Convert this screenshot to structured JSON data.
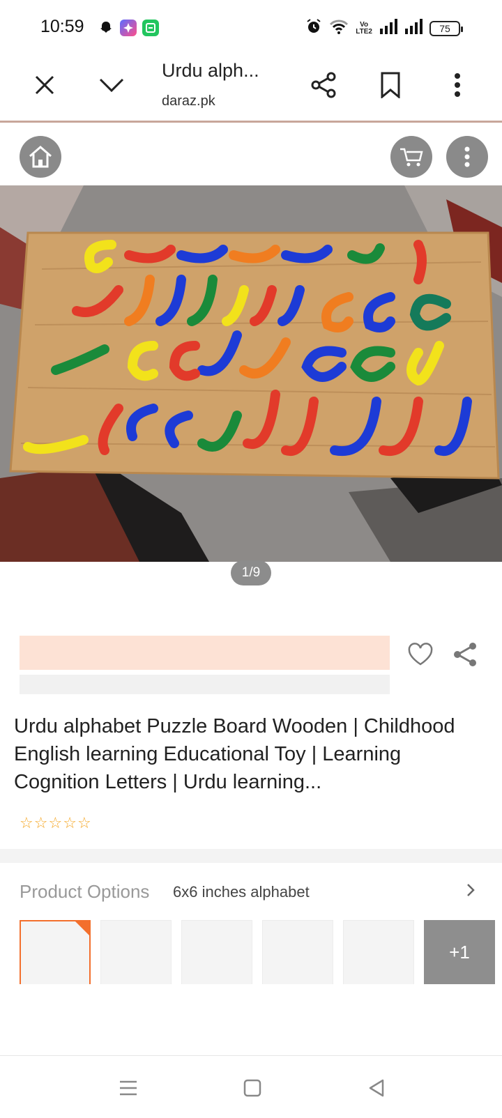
{
  "status_bar": {
    "time": "10:59",
    "battery": "75",
    "volte": "VoLTE2"
  },
  "tab_bar": {
    "title": "Urdu alph...",
    "url": "daraz.pk"
  },
  "gallery": {
    "counter": "1/9",
    "current": 1,
    "total": 9
  },
  "product": {
    "title": "Urdu alphabet Puzzle Board Wooden | Childhood English learning Educational Toy | Learning Cognition Letters | Urdu learning...",
    "rating_stars": 0
  },
  "options": {
    "label": "Product Options",
    "value": "6x6 inches alphabet",
    "more_label": "+1"
  },
  "colors": {
    "accent": "#f36f2c",
    "price_placeholder": "#fde2d5",
    "star": "#f5a623"
  }
}
